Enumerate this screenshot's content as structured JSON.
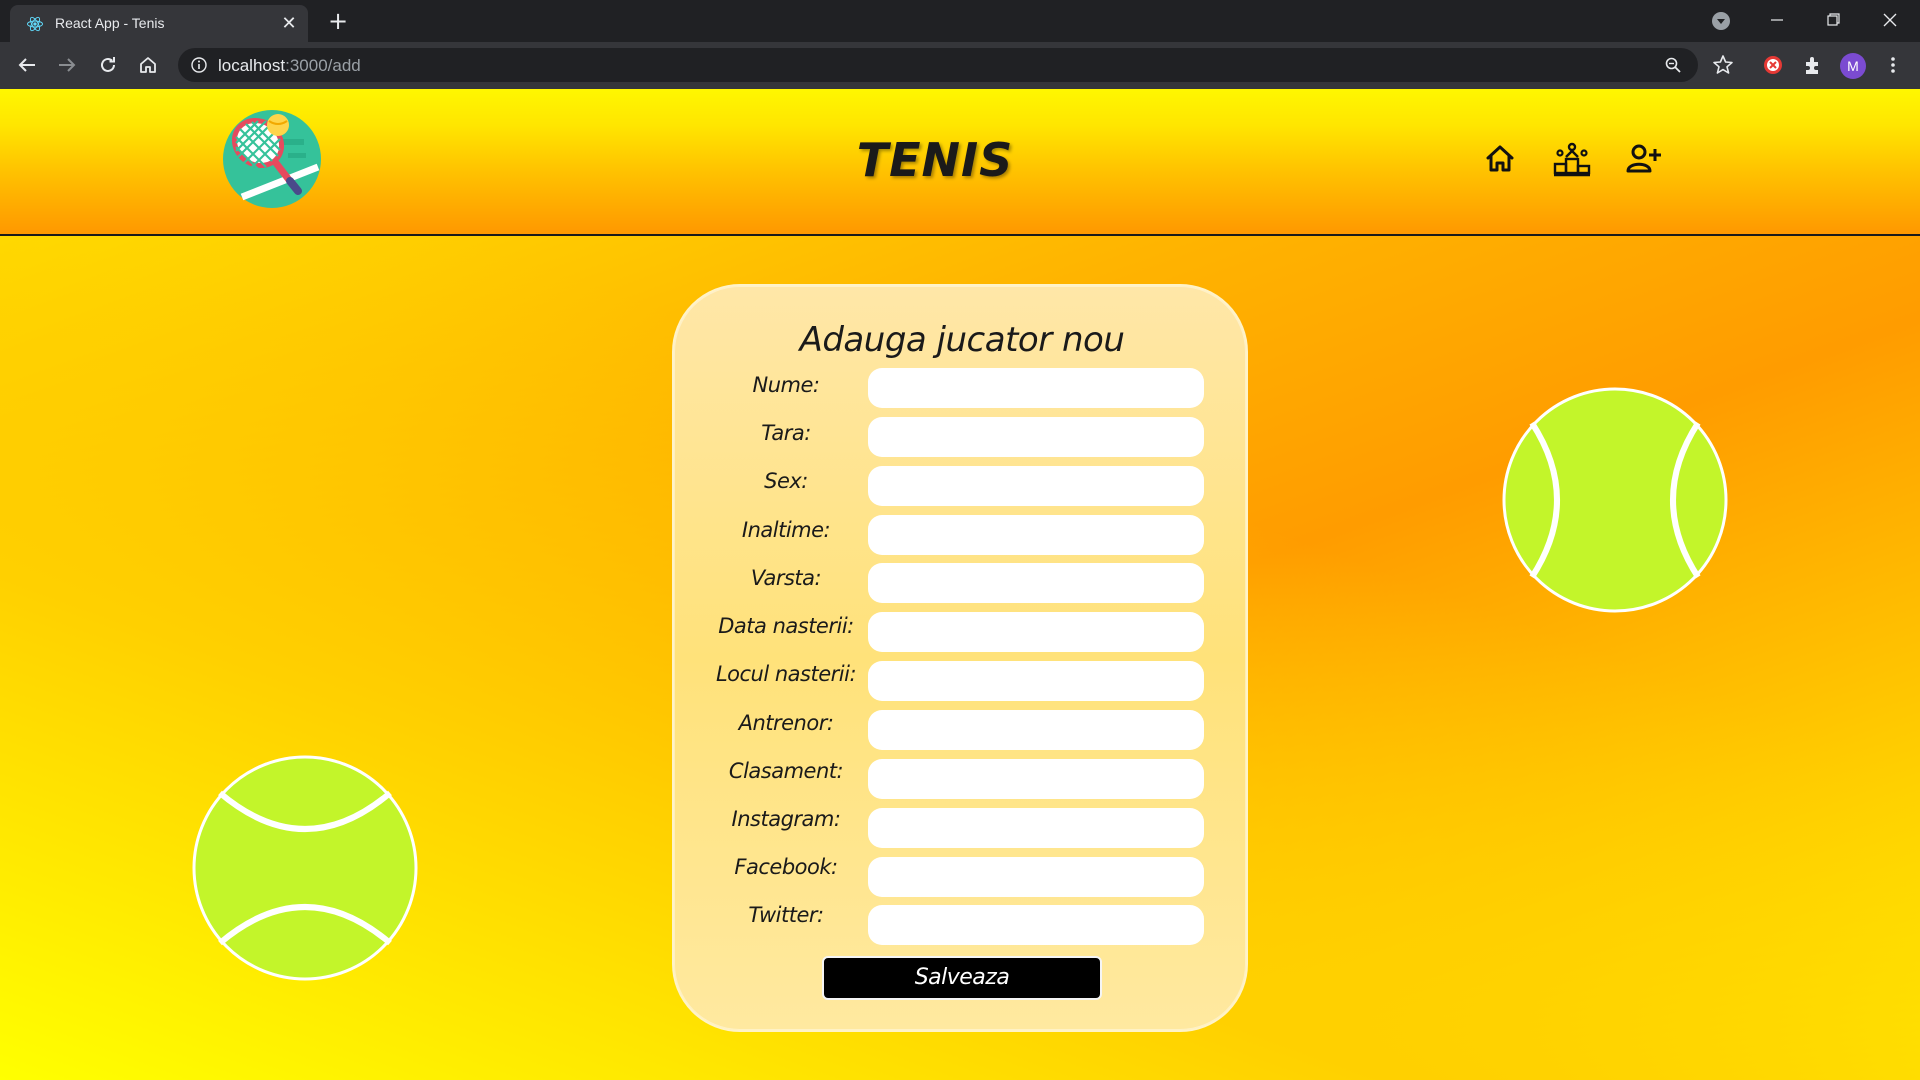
{
  "browser": {
    "tab_title": "React App - Tenis",
    "url_host": "localhost",
    "url_rest": ":3000/add",
    "profile_initial": "M"
  },
  "header": {
    "brand": "TENIS",
    "nav": [
      "home-icon",
      "podium-icon",
      "add-user-icon"
    ]
  },
  "form": {
    "title": "Adauga jucator nou",
    "fields": [
      {
        "label": "Nume:",
        "value": ""
      },
      {
        "label": "Tara:",
        "value": ""
      },
      {
        "label": "Sex:",
        "value": ""
      },
      {
        "label": "Inaltime:",
        "value": ""
      },
      {
        "label": "Varsta:",
        "value": ""
      },
      {
        "label": "Data nasterii:",
        "value": ""
      },
      {
        "label": "Locul nasterii:",
        "value": ""
      },
      {
        "label": "Antrenor:",
        "value": ""
      },
      {
        "label": "Clasament:",
        "value": ""
      },
      {
        "label": "Instagram:",
        "value": ""
      },
      {
        "label": "Facebook:",
        "value": ""
      },
      {
        "label": "Twitter:",
        "value": ""
      }
    ],
    "submit_label": "Salveaza"
  },
  "colors": {
    "ball": "#c3f52a",
    "accent": "#ffb300"
  }
}
